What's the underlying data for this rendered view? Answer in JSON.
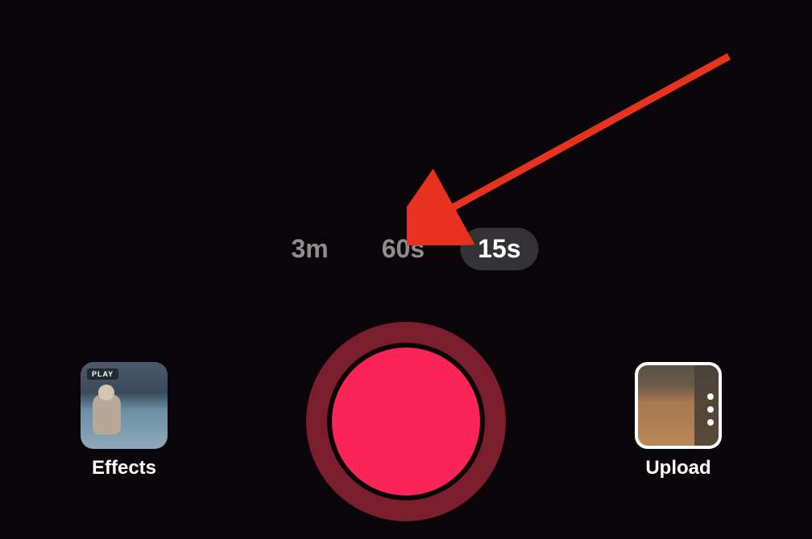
{
  "duration_options": {
    "option_0": "3m",
    "option_1": "60s",
    "option_2": "15s"
  },
  "active_duration_index": 2,
  "effects": {
    "label": "Effects",
    "badge": "PLAY"
  },
  "upload": {
    "label": "Upload"
  },
  "colors": {
    "record_inner": "#fa2457",
    "record_outer": "#7a1e2e",
    "active_pill": "#333335",
    "inactive_text": "#8e8e8e",
    "arrow": "#e6321e"
  }
}
